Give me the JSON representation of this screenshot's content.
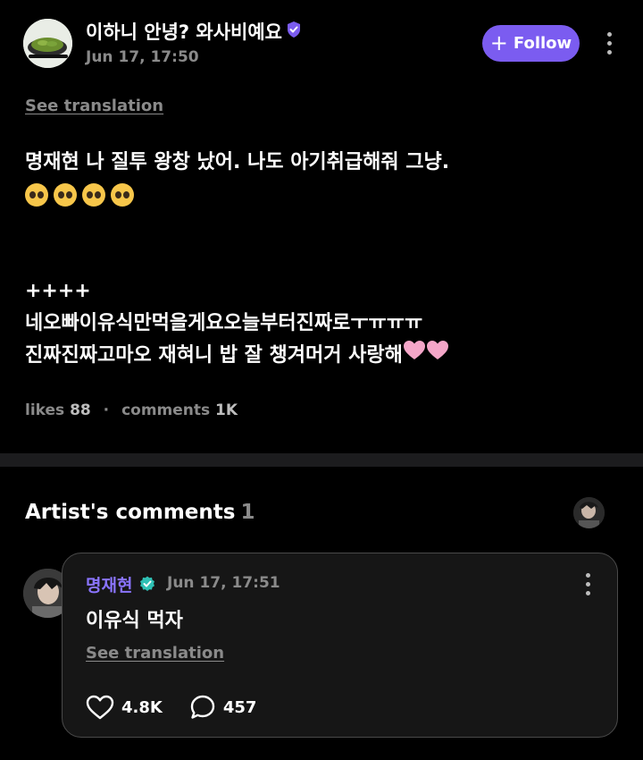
{
  "post": {
    "username": "이하니 안녕? 와사비예요",
    "timestamp": "Jun 17, 17:50",
    "follow_label": "Follow",
    "see_translation": "See translation",
    "body_line1": "명재현 나 질투 왕창 났어. 나도 아기취급해줘 그냥.",
    "body_plus": "++++",
    "body_line2": "네오빠이유식만먹을게요오늘부터진짜로ㅜㅠㅠㅠ",
    "body_line3": "진짜진짜고마오 재혀니 밥 잘 챙겨머거 사랑해",
    "likes_label": "likes",
    "likes_count": "88",
    "comments_label": "comments",
    "comments_count": "1K"
  },
  "artist_comments": {
    "title": "Artist's comments",
    "count": "1"
  },
  "comment": {
    "author": "명재현",
    "timestamp": "Jun 17, 17:51",
    "text": "이유식 먹자",
    "see_translation": "See translation",
    "likes": "4.8K",
    "replies": "457"
  },
  "colors": {
    "accent": "#7b5cf0",
    "background": "#000000",
    "muted_text": "#8a8a8a",
    "artist_name": "#8a74ff",
    "heart_emoji": "#f4a6c8",
    "verified_teal": "#2fc0b4"
  },
  "icons": [
    "verified-badge-icon",
    "plus-icon",
    "more-vertical-icon",
    "pleading-face-emoji",
    "pink-heart-emoji",
    "heart-outline-icon",
    "comment-bubble-icon"
  ]
}
